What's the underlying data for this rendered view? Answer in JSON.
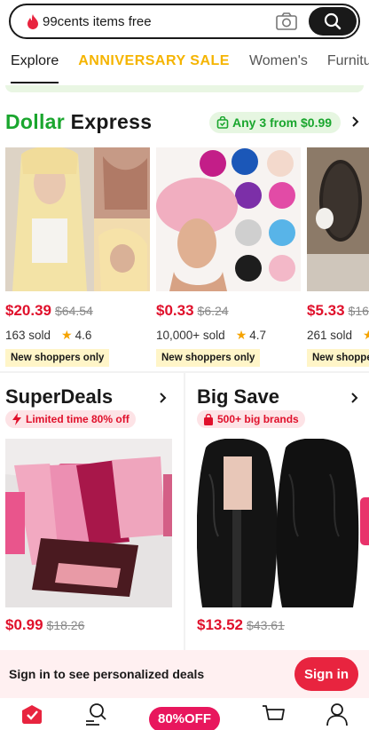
{
  "search": {
    "text": "99cents items free"
  },
  "tabs": [
    "Explore",
    "ANNIVERSARY SALE",
    "Women's",
    "Furnitu"
  ],
  "dollar_express": {
    "title_green": "Dollar",
    "title_black": " Express",
    "badge": "Any 3 from $0.99",
    "products": [
      {
        "price": "$20.39",
        "old_price": "$64.54",
        "sold": "163 sold",
        "rating": "4.6",
        "tag": "New shoppers only"
      },
      {
        "price": "$0.33",
        "old_price": "$6.24",
        "sold": "10,000+ sold",
        "rating": "4.7",
        "tag": "New shoppers only"
      },
      {
        "price": "$5.33",
        "old_price": "$16",
        "sold": "261 sold",
        "rating": "",
        "tag": "New shoppe"
      }
    ]
  },
  "superdeals": {
    "title": "SuperDeals",
    "badge": "Limited time 80% off",
    "price": "$0.99",
    "old_price": "$18.26"
  },
  "bigsave": {
    "title": "Big Save",
    "badge": "500+ big brands",
    "price": "$13.52",
    "old_price": "$43.61"
  },
  "signin_bar": {
    "text": "Sign in to see personalized deals",
    "button": "Sign in"
  },
  "bottom_nav": {
    "promo": "80%OFF"
  },
  "colors": {
    "accent_red": "#e0102b",
    "green": "#1aa62e",
    "pink": "#e8175d",
    "sale_yellow": "#f5b400"
  },
  "icons": [
    "fire-icon",
    "camera-icon",
    "search-icon",
    "shopping-bag-icon",
    "chevron-right-icon",
    "lightning-icon",
    "home-icon",
    "search-people-icon",
    "cart-icon",
    "profile-icon"
  ]
}
